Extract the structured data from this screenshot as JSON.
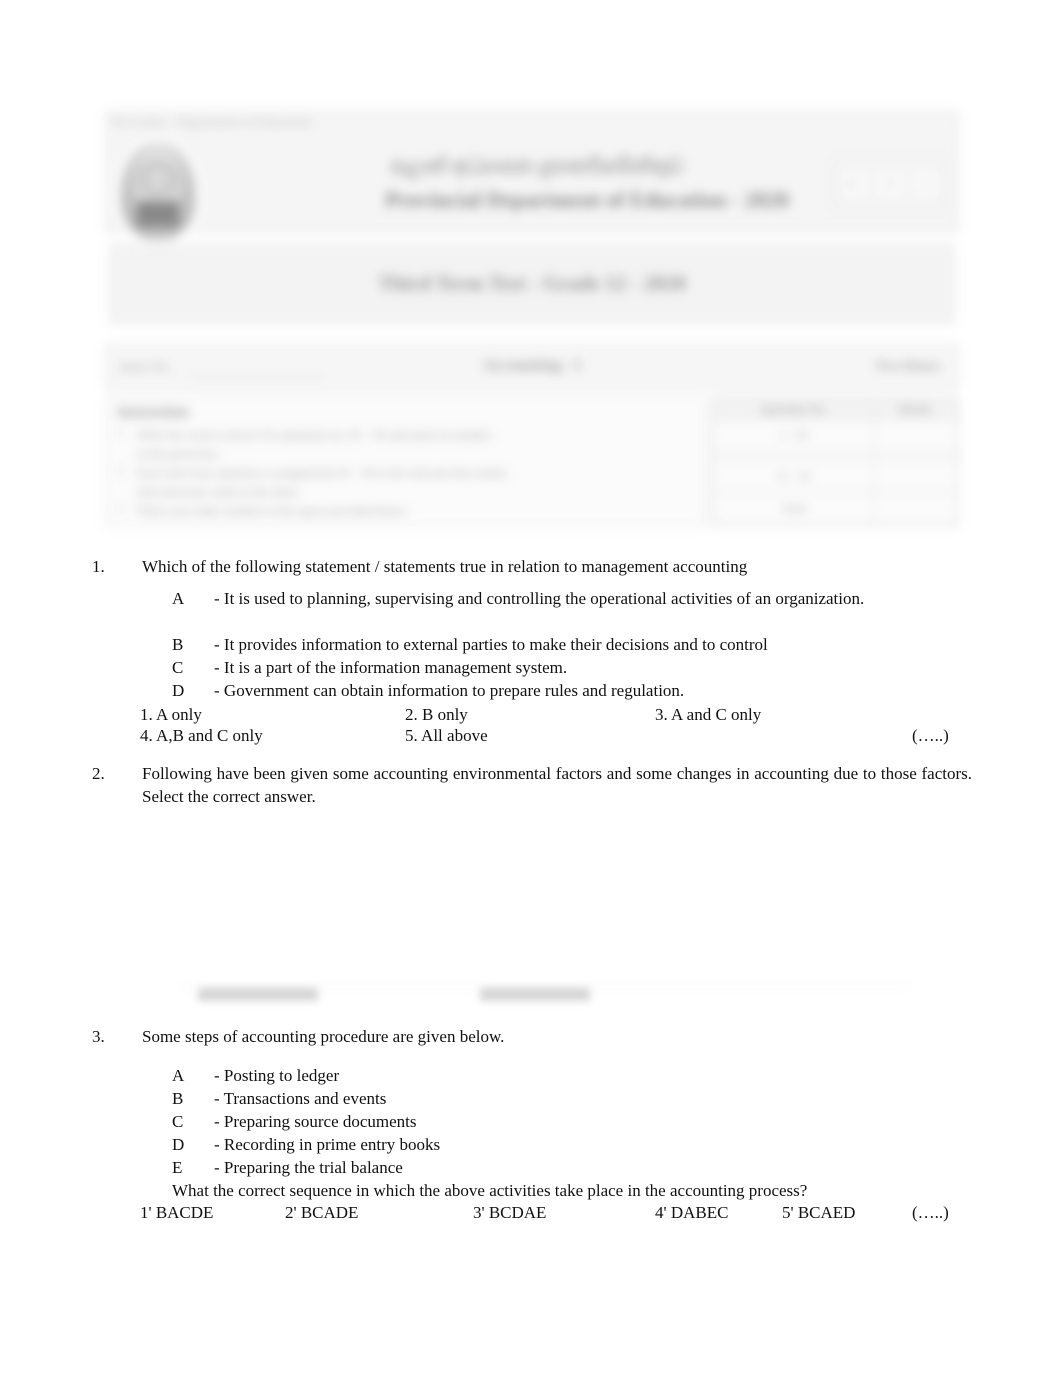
{
  "document": {
    "type": "examination-paper",
    "page_background": "#ffffff",
    "text_color": "#111111"
  },
  "header": {
    "redacted": true,
    "top_line": "Sri Lanka  -  Department of Education",
    "title_line_sinhala": "පළාත් අධ්‍යාපන දැපාර්තමේන්තුව",
    "title_line_english": "Provincial Department of Education  -  2020",
    "badges": [
      "01",
      "II",
      "A"
    ],
    "exam_title": "Third Term Test  -  Grade 12  -  2020",
    "index_label": "Index No.",
    "subject": "Accounting  -  I",
    "duration": "Two Hours",
    "instructions_title": "Instructions",
    "instructions": [
      "Write the correct answer for questions no. 01 - 30 and mark its number.",
      "in the given box.",
      "Each and every question is assigned the 01 - 30 in the relevant four marks.",
      "and answered. mark in the sheet.",
      "Write your index number in the space provided below."
    ],
    "marks_table": {
      "columns": [
        "Question No.",
        "Marks"
      ],
      "rows": [
        [
          "1 - 30",
          ""
        ],
        [
          "",
          ""
        ],
        [
          "31 - 35",
          ""
        ],
        [
          "Total",
          ""
        ]
      ]
    }
  },
  "questions": [
    {
      "number": "1.",
      "stem": "Which of the following statement / statements true in relation to management accounting",
      "statements": [
        {
          "letter": "A",
          "text": "- It is used to planning, supervising and controlling the operational activities of an organization."
        },
        {
          "letter": "B",
          "text": "- It provides information to external parties to make their decisions and to control"
        },
        {
          "letter": "C",
          "text": "- It is a part of the information management system."
        },
        {
          "letter": "D",
          "text": "- Government can obtain information to prepare rules and regulation."
        }
      ],
      "options_row1": [
        "1.  A only",
        "2.  B only",
        "3.  A and C only"
      ],
      "options_row2": [
        "4.  A,B and C only",
        "5.  All above"
      ],
      "answer_blank": "(…..)"
    },
    {
      "number": "2.",
      "stem": "Following have been given some accounting environmental factors and some changes in accounting due to those factors. Select the correct answer.",
      "redacted_content": true
    },
    {
      "number": "3.",
      "stem": "Some steps of accounting procedure are given below.",
      "statements": [
        {
          "letter": "A",
          "text": "-  Posting  to  ledger"
        },
        {
          "letter": "B",
          "text": "-  Transactions  and  events"
        },
        {
          "letter": "C",
          "text": "-  Preparing  source  documents"
        },
        {
          "letter": "D",
          "text": "-  Recording  in  prime  entry  books"
        },
        {
          "letter": "E",
          "text": "-  Preparing  the  trial  balance"
        }
      ],
      "sub_question": "What the correct sequence in which the above activities take place in the accounting process?",
      "options": [
        "1'  BACDE",
        "2'  BCADE",
        "3'  BCDAE",
        "4'  DABEC",
        "5'  BCAED"
      ],
      "answer_blank": "(…..)"
    }
  ]
}
